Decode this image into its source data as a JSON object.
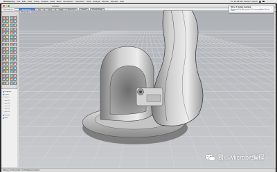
{
  "menubar": {
    "app_name": "Rhinoceros",
    "items": [
      "File",
      "Edit",
      "View",
      "Curve",
      "Surface",
      "Solid",
      "Mesh",
      "Dimension",
      "Transform",
      "Tools",
      "Analyze",
      "Render",
      "Window",
      "Help"
    ],
    "clock": "Fri 10:38 AM",
    "user": "Robert Lubeck"
  },
  "window": {
    "title": "Untitled"
  },
  "command": {
    "label": "Grid Snap",
    "pills": [
      "Ortho",
      "Planar",
      "Osnap",
      "SmartTrack",
      "Gumball",
      "Record History"
    ],
    "active_pill": "Osnap"
  },
  "viewport_tabs": [
    "Perspective",
    "Top",
    "Front",
    "Right"
  ],
  "active_viewport": "Perspective",
  "viewport_label": "Perspective",
  "notification": {
    "title": "Rhino 5 Update Available",
    "body": "Rhinoceros 5 for Mac version 5.1.1 is now available. Click to install."
  },
  "side_panel": {
    "rows": [
      {
        "label": "Properties",
        "type": "header"
      },
      {
        "label": "Layers",
        "type": "header"
      },
      {
        "label": "Default",
        "type": "sub"
      },
      {
        "label": "Layer 01",
        "type": "sub"
      },
      {
        "label": "Layer 02",
        "type": "sub"
      },
      {
        "label": "Layer 03",
        "type": "sub"
      },
      {
        "label": "Layer 04",
        "type": "sub"
      },
      {
        "label": "Layer 05",
        "type": "sub"
      },
      {
        "label": "Display",
        "type": "header"
      },
      {
        "label": "Help",
        "type": "header"
      }
    ]
  },
  "status": {
    "text": "CPlane x 12.345  y 8.901  z 0.000    Millimeters    Default"
  },
  "watermark": {
    "text": "易心Microbit编程"
  },
  "colors": {
    "accent": "#3b82e0",
    "viewport_bg": "#b9bcc0",
    "model_light": "#d9d9d9",
    "model_dark": "#8e8e8e"
  }
}
